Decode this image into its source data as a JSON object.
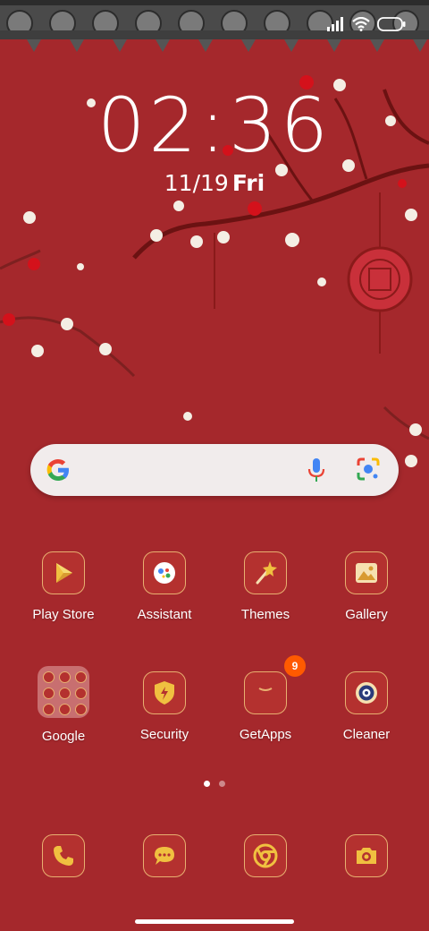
{
  "status": {
    "signal": "signal-bars-icon",
    "wifi": "wifi-icon",
    "battery": "battery-icon"
  },
  "lockclock": {
    "time": "02:36",
    "date": "11/19",
    "weekday": "Fri"
  },
  "search": {
    "logo": "google-g-icon",
    "mic": "mic-icon",
    "lens": "lens-icon"
  },
  "apps_row1": [
    {
      "label": "Play Store",
      "icon": "play-store-icon"
    },
    {
      "label": "Assistant",
      "icon": "assistant-icon"
    },
    {
      "label": "Themes",
      "icon": "themes-wand-icon"
    },
    {
      "label": "Gallery",
      "icon": "gallery-icon"
    }
  ],
  "apps_row2": [
    {
      "label": "Google",
      "icon": "google-folder-icon"
    },
    {
      "label": "Security",
      "icon": "security-shield-icon"
    },
    {
      "label": "GetApps",
      "icon": "getapps-bag-icon",
      "badge": "9"
    },
    {
      "label": "Cleaner",
      "icon": "cleaner-icon"
    }
  ],
  "pager": {
    "pages": 2,
    "current": 1
  },
  "dock": [
    {
      "icon": "phone-icon"
    },
    {
      "icon": "messages-icon"
    },
    {
      "icon": "chrome-icon"
    },
    {
      "icon": "camera-icon"
    }
  ],
  "colors": {
    "background": "#a5282c",
    "icon_bg": "#b4312f",
    "icon_border": "#e8b070",
    "badge": "#ff5a00"
  }
}
